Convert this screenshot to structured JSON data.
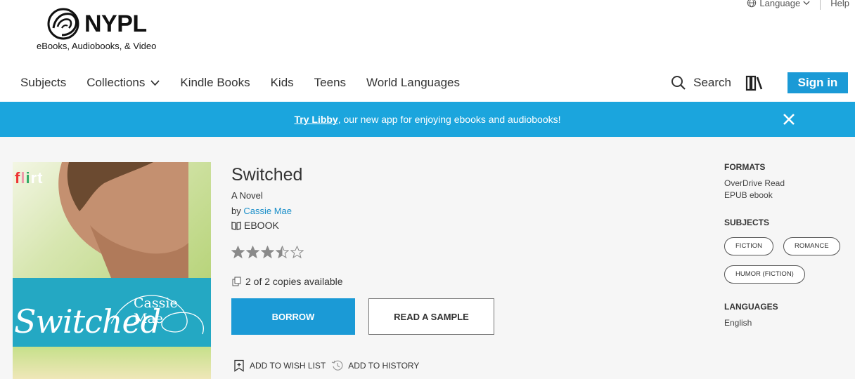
{
  "utility": {
    "language": "Language",
    "help": "Help"
  },
  "logo": {
    "wordmark": "NYPL",
    "tagline": "eBooks, Audiobooks, & Video"
  },
  "nav": {
    "links": [
      "Subjects",
      "Collections",
      "Kindle Books",
      "Kids",
      "Teens",
      "World Languages"
    ],
    "search_label": "Search",
    "signin_label": "Sign in"
  },
  "banner": {
    "link_text": "Try Libby",
    "rest_text": ", our new app for enjoying ebooks and audiobooks!"
  },
  "cover": {
    "series_mark": "flirt",
    "author": "Cassie Mae",
    "title": "Switched"
  },
  "book": {
    "title": "Switched",
    "subtitle": "A Novel",
    "by_prefix": "by",
    "author": "Cassie Mae",
    "format": "EBOOK",
    "rating": 3.5,
    "rating_max": 5,
    "availability": "2 of 2 copies available"
  },
  "buttons": {
    "borrow": "BORROW",
    "sample": "READ A SAMPLE"
  },
  "actions": {
    "wish_list": "ADD TO WISH LIST",
    "history": "ADD TO HISTORY"
  },
  "sidebar": {
    "formats_heading": "FORMATS",
    "formats": [
      "OverDrive Read",
      "EPUB ebook"
    ],
    "subjects_heading": "SUBJECTS",
    "subjects": [
      "FICTION",
      "ROMANCE",
      "HUMOR (FICTION)"
    ],
    "languages_heading": "LANGUAGES",
    "languages": [
      "English"
    ]
  },
  "colors": {
    "accent": "#1b9ad6",
    "banner": "#1ba5dd",
    "link": "#1b8fc9",
    "star": "#8a8a8a"
  }
}
